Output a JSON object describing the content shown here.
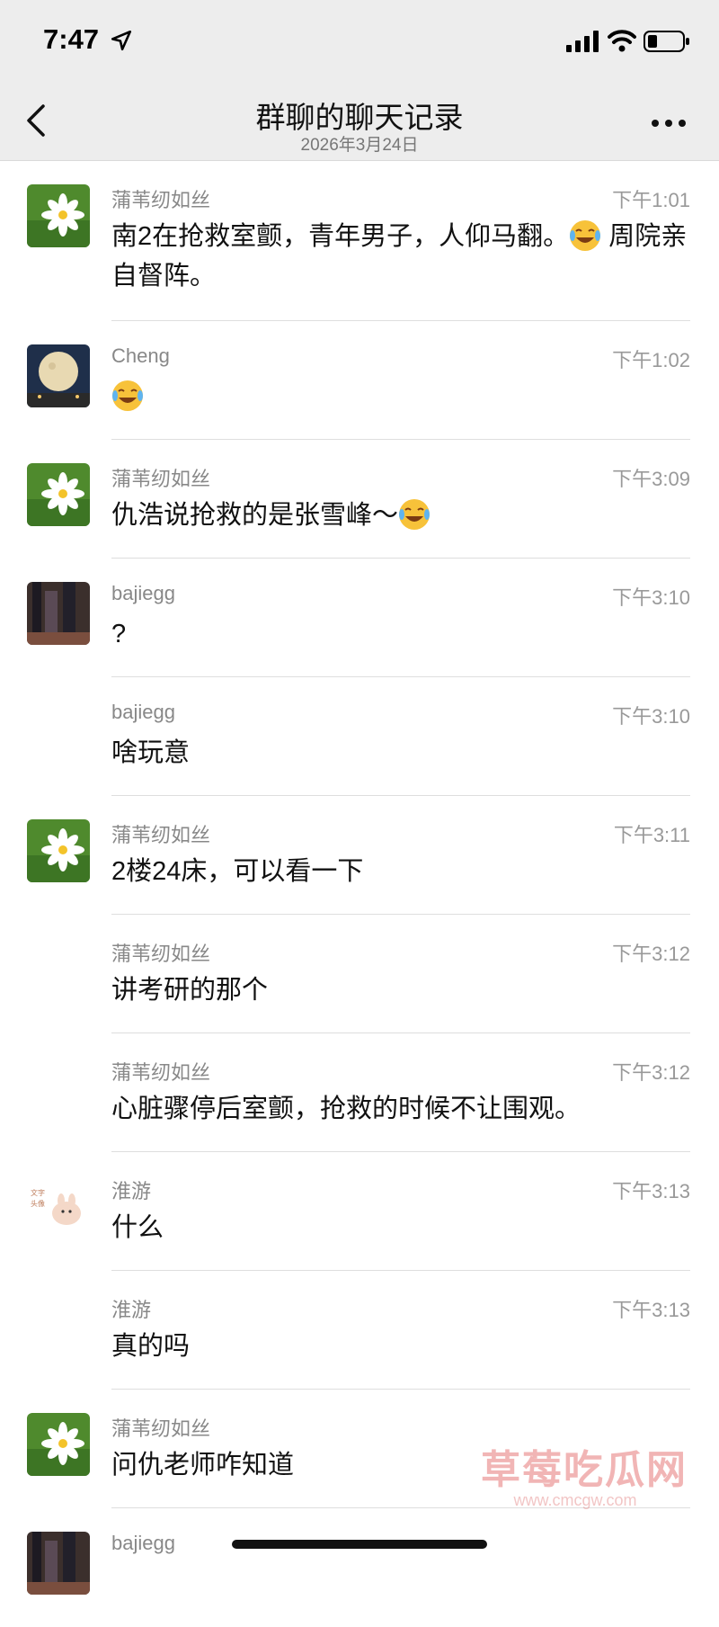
{
  "status_bar": {
    "time": "7:47"
  },
  "nav": {
    "title": "群聊的聊天记录",
    "subtitle": "2026年3月24日"
  },
  "messages": [
    {
      "sender": "蒲苇纫如丝",
      "time": "下午1:01",
      "text": "南2在抢救室颤，青年男子，人仰马翻。",
      "text2": "周院亲自督阵。",
      "avatar": "daisy-avatar"
    },
    {
      "sender": "Cheng",
      "time": "下午1:02",
      "text": "",
      "avatar": "moon-avatar"
    },
    {
      "sender": "蒲苇纫如丝",
      "time": "下午3:09",
      "text": "仇浩说抢救的是张雪峰～",
      "avatar": "daisy-avatar"
    },
    {
      "sender": "bajiegg",
      "time": "下午3:10",
      "text": "?",
      "avatar": "street-avatar"
    },
    {
      "sender": "bajiegg",
      "time": "下午3:10",
      "text": "啥玩意",
      "avatar": ""
    },
    {
      "sender": "蒲苇纫如丝",
      "time": "下午3:11",
      "text": "2楼24床，可以看一下",
      "avatar": "daisy-avatar"
    },
    {
      "sender": "蒲苇纫如丝",
      "time": "下午3:12",
      "text": "讲考研的那个",
      "avatar": ""
    },
    {
      "sender": "蒲苇纫如丝",
      "time": "下午3:12",
      "text": "心脏骤停后室颤，抢救的时候不让围观。",
      "avatar": ""
    },
    {
      "sender": "淮游",
      "time": "下午3:13",
      "text": "什么",
      "avatar": "bunny-avatar"
    },
    {
      "sender": "淮游",
      "time": "下午3:13",
      "text": "真的吗",
      "avatar": ""
    },
    {
      "sender": "蒲苇纫如丝",
      "time": "",
      "text": "问仇老师咋知道",
      "avatar": "daisy-avatar"
    },
    {
      "sender": "bajiegg",
      "time": "",
      "text": "",
      "avatar": "street-avatar"
    }
  ],
  "watermark": {
    "text": "草莓吃瓜网",
    "url": "www.cmcgw.com"
  },
  "colors": {
    "nav_bg": "#ededed",
    "divider": "#dedede",
    "meta": "#888888"
  }
}
